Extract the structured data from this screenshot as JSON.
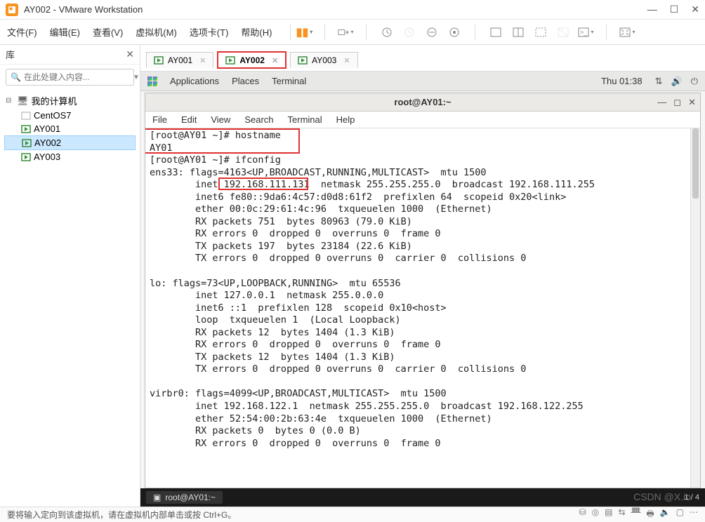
{
  "window": {
    "title": "AY002 - VMware Workstation"
  },
  "menubar": {
    "items": [
      "文件(F)",
      "编辑(E)",
      "查看(V)",
      "虚拟机(M)",
      "选项卡(T)",
      "帮助(H)"
    ]
  },
  "sidebar": {
    "title": "库",
    "search_placeholder": "在此处键入内容...",
    "root": "我的计算机",
    "items": [
      "CentOS7",
      "AY001",
      "AY002",
      "AY003"
    ],
    "selected": "AY002"
  },
  "tabs": [
    {
      "label": "AY001",
      "active": false
    },
    {
      "label": "AY002",
      "active": true
    },
    {
      "label": "AY003",
      "active": false
    }
  ],
  "guest_bar": {
    "apps": "Applications",
    "places": "Places",
    "terminal": "Terminal",
    "clock": "Thu 01:38"
  },
  "terminal": {
    "title": "root@AY01:~",
    "menus": [
      "File",
      "Edit",
      "View",
      "Search",
      "Terminal",
      "Help"
    ],
    "lines": [
      "[root@AY01 ~]# hostname",
      "AY01",
      "[root@AY01 ~]# ifconfig",
      "ens33: flags=4163<UP,BROADCAST,RUNNING,MULTICAST>  mtu 1500",
      "        inet 192.168.111.131  netmask 255.255.255.0  broadcast 192.168.111.255",
      "        inet6 fe80::9da6:4c57:d0d8:61f2  prefixlen 64  scopeid 0x20<link>",
      "        ether 00:0c:29:61:4c:96  txqueuelen 1000  (Ethernet)",
      "        RX packets 751  bytes 80963 (79.0 KiB)",
      "        RX errors 0  dropped 0  overruns 0  frame 0",
      "        TX packets 197  bytes 23184 (22.6 KiB)",
      "        TX errors 0  dropped 0 overruns 0  carrier 0  collisions 0",
      "",
      "lo: flags=73<UP,LOOPBACK,RUNNING>  mtu 65536",
      "        inet 127.0.0.1  netmask 255.0.0.0",
      "        inet6 ::1  prefixlen 128  scopeid 0x10<host>",
      "        loop  txqueuelen 1  (Local Loopback)",
      "        RX packets 12  bytes 1404 (1.3 KiB)",
      "        RX errors 0  dropped 0  overruns 0  frame 0",
      "        TX packets 12  bytes 1404 (1.3 KiB)",
      "        TX errors 0  dropped 0 overruns 0  carrier 0  collisions 0",
      "",
      "virbr0: flags=4099<UP,BROADCAST,MULTICAST>  mtu 1500",
      "        inet 192.168.122.1  netmask 255.255.255.0  broadcast 192.168.122.255",
      "        ether 52:54:00:2b:63:4e  txqueuelen 1000  (Ethernet)",
      "        RX packets 0  bytes 0 (0.0 B)",
      "        RX errors 0  dropped 0  overruns 0  frame 0"
    ],
    "highlight_ip": "192.168.111.131",
    "highlight_cmd": "[root@AY01 ~]# hostname"
  },
  "guest_taskbar": {
    "item": "root@AY01:~",
    "workspace": "1 / 4"
  },
  "statusbar": {
    "text": "要将输入定向到该虚拟机，请在虚拟机内部单击或按 Ctrl+G。"
  },
  "watermark": "CSDN @X.io"
}
